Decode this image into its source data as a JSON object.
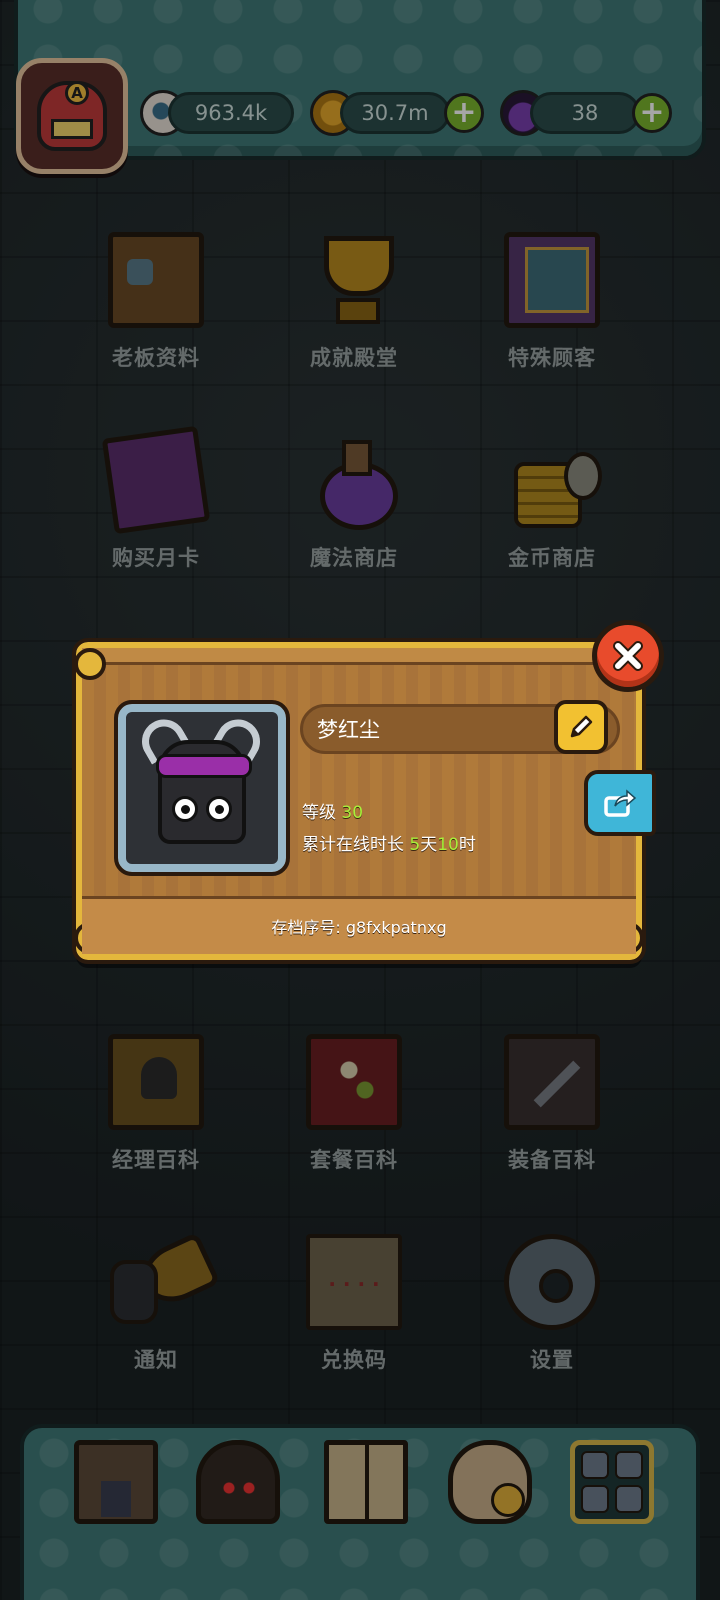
{
  "resources": {
    "eyes": "963.4k",
    "coins": "30.7m",
    "potions": "38"
  },
  "menu": [
    {
      "label": "老板资料"
    },
    {
      "label": "成就殿堂"
    },
    {
      "label": "特殊顾客"
    },
    {
      "label": "购买月卡"
    },
    {
      "label": "魔法商店"
    },
    {
      "label": "金币商店"
    },
    {
      "label": "经理百科"
    },
    {
      "label": "套餐百科"
    },
    {
      "label": "装备百科"
    },
    {
      "label": "通知"
    },
    {
      "label": "兑换码"
    },
    {
      "label": "设置"
    }
  ],
  "profile": {
    "name": "梦红尘",
    "level_label": "等级",
    "level": "30",
    "online_label": "累计在线时长",
    "online_days": "5",
    "online_days_unit": "天",
    "online_hours": "10",
    "online_hours_unit": "时",
    "save_id_label": "存档序号: ",
    "save_id": "g8fxkpatnxg"
  },
  "colors": {
    "accent_gold": "#e4b73c",
    "close_red": "#e84b2c",
    "share_blue": "#3fb6d8",
    "level_green": "#a8f03a"
  },
  "icons": {
    "close": "close-icon",
    "edit": "pencil-icon",
    "share": "share-icon"
  }
}
